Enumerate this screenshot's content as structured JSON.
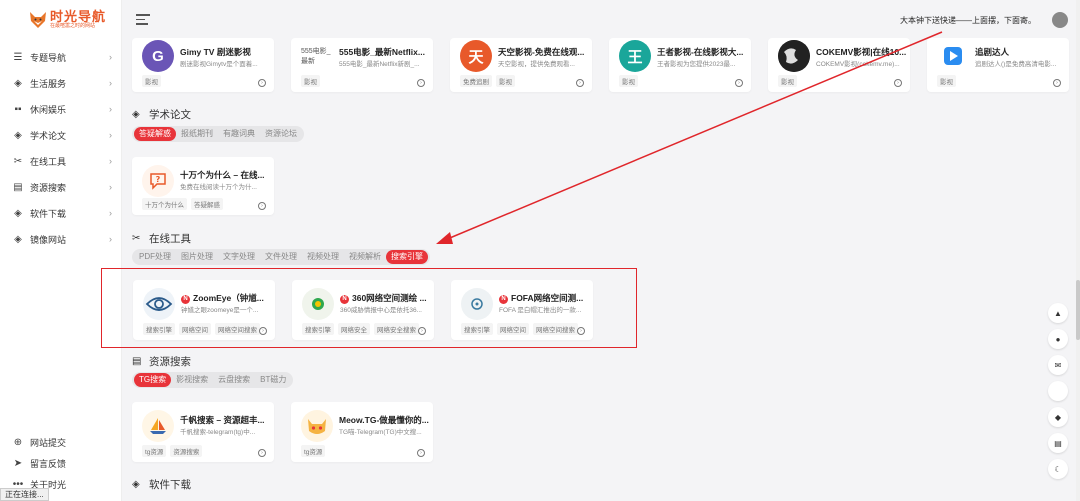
{
  "logo": {
    "title": "时光导航",
    "subtitle": "在最喧嚣之时的网站"
  },
  "header": {
    "notice": "大本钟下送快递——上面摆，下面寄。"
  },
  "sidebar": {
    "items": [
      {
        "label": "专题导航",
        "icon": "list-icon"
      },
      {
        "label": "生活服务",
        "icon": "layers-icon"
      },
      {
        "label": "休闲娱乐",
        "icon": "grid-icon"
      },
      {
        "label": "学术论文",
        "icon": "layers-icon"
      },
      {
        "label": "在线工具",
        "icon": "tools-icon"
      },
      {
        "label": "资源搜索",
        "icon": "doc-icon"
      },
      {
        "label": "软件下载",
        "icon": "layers-icon"
      },
      {
        "label": "镜像网站",
        "icon": "layers-icon"
      }
    ],
    "bottom": [
      {
        "label": "网站提交",
        "icon": "plus-circle-icon"
      },
      {
        "label": "留言反馈",
        "icon": "send-icon"
      },
      {
        "label": "关于时光",
        "icon": "more-icon"
      }
    ]
  },
  "status": "正在连接...",
  "top_cards": [
    {
      "title": "Gimy TV 剧迷影视",
      "desc": "剧迷影视Gimytv是个面着...",
      "tag": "影视",
      "icon_text": "G",
      "color": "#6a55b6"
    },
    {
      "title": "555电影_最新Netflix...",
      "desc": "555电影_最新Netflix新剧_...",
      "tag": "影视",
      "icon_text": "555电影_最新",
      "color": "#ffffff"
    },
    {
      "title": "天空影视-免费在线观...",
      "desc": "天空影视，提供免费观看...",
      "tag": "免费追剧",
      "tag2": "影视",
      "icon_text": "天",
      "color": "#e8592a"
    },
    {
      "title": "王者影视-在线影视大...",
      "desc": "王者影视为您提供2023最...",
      "tag": "影视",
      "icon_text": "王",
      "color": "#1aa69a"
    },
    {
      "title": "COKEMV影视|在线10...",
      "desc": "COKEMV影视(cokemv.me)...",
      "tag": "影视",
      "icon_text": "",
      "color": "#333333"
    },
    {
      "title": "追剧达人",
      "desc": "追剧达人()是免费高清电影...",
      "tag": "影视",
      "icon_text": "",
      "color": "#ffffff"
    }
  ],
  "academic": {
    "title": "学术论文",
    "tabs": [
      "答疑解惑",
      "报纸期刊",
      "有趣词典",
      "资源论坛"
    ],
    "card": {
      "title": "十万个为什么 – 在线...",
      "desc": "免费在线阅读十万个为什...",
      "tags": [
        "十万个为什么",
        "答疑解惑"
      ]
    }
  },
  "tools": {
    "title": "在线工具",
    "tabs": [
      "PDF处理",
      "图片处理",
      "文字处理",
      "文件处理",
      "视频处理",
      "视频解析",
      "搜索引擎"
    ],
    "cards": [
      {
        "badge": "N",
        "title": "ZoomEye（钟馗...",
        "desc": "钟馗之眼zoomeye是一个...",
        "tags": [
          "搜索引擎",
          "网络空间",
          "网络空间搜索"
        ]
      },
      {
        "badge": "N",
        "title": "360网络空间测绘 ...",
        "desc": "360威胁情报中心是依托36...",
        "tags": [
          "搜索引擎",
          "网络安全",
          "网络安全搜索"
        ]
      },
      {
        "badge": "N",
        "title": "FOFA网络空间测...",
        "desc": "FOFA 是白帽汇推出的一款...",
        "tags": [
          "搜索引擎",
          "网络空间",
          "网络空间搜索"
        ]
      }
    ]
  },
  "resources": {
    "title": "资源搜索",
    "tabs": [
      "TG搜索",
      "影视搜索",
      "云盘搜索",
      "BT磁力"
    ],
    "cards": [
      {
        "title": "千帆搜索 – 资源超丰...",
        "desc": "千帆搜索-telegram(tg)中...",
        "tags": [
          "tg资源",
          "资源搜索"
        ]
      },
      {
        "title": "Meow.TG-做最懂你的...",
        "desc": "TG喵-Telegram(TG)中文搜...",
        "tags": [
          "tg资源"
        ]
      }
    ]
  },
  "software": {
    "title": "软件下载"
  },
  "float_buttons": [
    "up-arrow-icon",
    "bell-icon",
    "mail-icon",
    "blank",
    "tag-icon",
    "list-icon",
    "moon-icon"
  ],
  "colors": {
    "accent": "#e8343a",
    "logo": "#e85a2a",
    "annotation": "#e0262b"
  }
}
